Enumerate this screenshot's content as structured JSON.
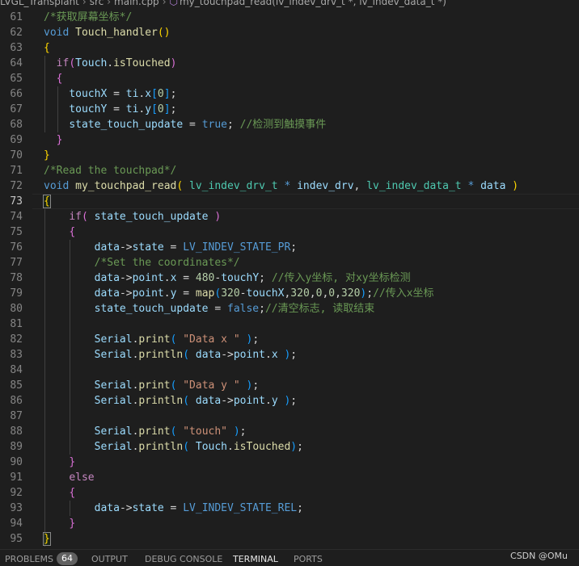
{
  "breadcrumb": {
    "items": [
      "LVGL_Transplant",
      "src",
      "main.cpp"
    ],
    "symbol": "my_touchpad_read(lv_indev_drv_t *, lv_indev_data_t *)",
    "symbol_icon": "cube-method-icon"
  },
  "editor": {
    "current_line": 73,
    "lines": [
      {
        "n": "61",
        "tokens": [
          [
            "cm",
            "/*获取屏幕坐标*/"
          ]
        ]
      },
      {
        "n": "62",
        "tokens": [
          [
            "kw",
            "void"
          ],
          [
            "txt",
            " "
          ],
          [
            "fn",
            "Touch_handler"
          ],
          [
            "b1",
            "()"
          ]
        ]
      },
      {
        "n": "63",
        "tokens": [
          [
            "b1",
            "{"
          ]
        ]
      },
      {
        "n": "64",
        "tokens": [
          [
            "txt",
            "  "
          ],
          [
            "ctl",
            "if"
          ],
          [
            "b2",
            "("
          ],
          [
            "var",
            "Touch"
          ],
          [
            "txt",
            "."
          ],
          [
            "fn",
            "isTouched"
          ],
          [
            "b2",
            ")"
          ]
        ]
      },
      {
        "n": "65",
        "tokens": [
          [
            "txt",
            "  "
          ],
          [
            "b2",
            "{"
          ]
        ]
      },
      {
        "n": "66",
        "tokens": [
          [
            "txt",
            "    "
          ],
          [
            "var",
            "touchX"
          ],
          [
            "txt",
            " = "
          ],
          [
            "var",
            "ti"
          ],
          [
            "txt",
            "."
          ],
          [
            "var",
            "x"
          ],
          [
            "b3",
            "["
          ],
          [
            "num",
            "0"
          ],
          [
            "b3",
            "]"
          ],
          [
            "txt",
            ";"
          ]
        ]
      },
      {
        "n": "67",
        "tokens": [
          [
            "txt",
            "    "
          ],
          [
            "var",
            "touchY"
          ],
          [
            "txt",
            " = "
          ],
          [
            "var",
            "ti"
          ],
          [
            "txt",
            "."
          ],
          [
            "var",
            "y"
          ],
          [
            "b3",
            "["
          ],
          [
            "num",
            "0"
          ],
          [
            "b3",
            "]"
          ],
          [
            "txt",
            ";"
          ]
        ]
      },
      {
        "n": "68",
        "tokens": [
          [
            "txt",
            "    "
          ],
          [
            "var",
            "state_touch_update"
          ],
          [
            "txt",
            " = "
          ],
          [
            "const",
            "true"
          ],
          [
            "txt",
            "; "
          ],
          [
            "cm",
            "//检测到触摸事件"
          ]
        ]
      },
      {
        "n": "69",
        "tokens": [
          [
            "txt",
            "  "
          ],
          [
            "b2",
            "}"
          ]
        ]
      },
      {
        "n": "70",
        "tokens": [
          [
            "b1",
            "}"
          ]
        ]
      },
      {
        "n": "71",
        "tokens": [
          [
            "cm",
            "/*Read the touchpad*/"
          ]
        ]
      },
      {
        "n": "72",
        "tokens": [
          [
            "kw",
            "void"
          ],
          [
            "txt",
            " "
          ],
          [
            "fn",
            "my_touchpad_read"
          ],
          [
            "b1",
            "("
          ],
          [
            "txt",
            " "
          ],
          [
            "type",
            "lv_indev_drv_t"
          ],
          [
            "txt",
            " "
          ],
          [
            "kw",
            "*"
          ],
          [
            "txt",
            " "
          ],
          [
            "var",
            "indev_drv"
          ],
          [
            "txt",
            ", "
          ],
          [
            "type",
            "lv_indev_data_t"
          ],
          [
            "txt",
            " "
          ],
          [
            "kw",
            "*"
          ],
          [
            "txt",
            " "
          ],
          [
            "var",
            "data"
          ],
          [
            "txt",
            " "
          ],
          [
            "b1",
            ")"
          ]
        ]
      },
      {
        "n": "73",
        "tokens": [
          [
            "b1hl",
            "{"
          ]
        ]
      },
      {
        "n": "74",
        "tokens": [
          [
            "txt",
            "    "
          ],
          [
            "ctl",
            "if"
          ],
          [
            "b2",
            "("
          ],
          [
            "txt",
            " "
          ],
          [
            "var",
            "state_touch_update"
          ],
          [
            "txt",
            " "
          ],
          [
            "b2",
            ")"
          ]
        ]
      },
      {
        "n": "75",
        "tokens": [
          [
            "txt",
            "    "
          ],
          [
            "b2",
            "{"
          ]
        ]
      },
      {
        "n": "76",
        "tokens": [
          [
            "txt",
            "        "
          ],
          [
            "var",
            "data"
          ],
          [
            "txt",
            "->"
          ],
          [
            "var",
            "state"
          ],
          [
            "txt",
            " = "
          ],
          [
            "const",
            "LV_INDEV_STATE_PR"
          ],
          [
            "txt",
            ";"
          ]
        ]
      },
      {
        "n": "77",
        "tokens": [
          [
            "txt",
            "        "
          ],
          [
            "cm",
            "/*Set the coordinates*/"
          ]
        ]
      },
      {
        "n": "78",
        "tokens": [
          [
            "txt",
            "        "
          ],
          [
            "var",
            "data"
          ],
          [
            "txt",
            "->"
          ],
          [
            "var",
            "point"
          ],
          [
            "txt",
            "."
          ],
          [
            "var",
            "x"
          ],
          [
            "txt",
            " = "
          ],
          [
            "num",
            "480"
          ],
          [
            "txt",
            "-"
          ],
          [
            "var",
            "touchY"
          ],
          [
            "txt",
            "; "
          ],
          [
            "cm",
            "//传入y坐标, 对xy坐标检测"
          ]
        ]
      },
      {
        "n": "79",
        "tokens": [
          [
            "txt",
            "        "
          ],
          [
            "var",
            "data"
          ],
          [
            "txt",
            "->"
          ],
          [
            "var",
            "point"
          ],
          [
            "txt",
            "."
          ],
          [
            "var",
            "y"
          ],
          [
            "txt",
            " = "
          ],
          [
            "fn",
            "map"
          ],
          [
            "b3",
            "("
          ],
          [
            "num",
            "320"
          ],
          [
            "txt",
            "-"
          ],
          [
            "var",
            "touchX"
          ],
          [
            "txt",
            ","
          ],
          [
            "num",
            "320"
          ],
          [
            "txt",
            ","
          ],
          [
            "num",
            "0"
          ],
          [
            "txt",
            ","
          ],
          [
            "num",
            "0"
          ],
          [
            "txt",
            ","
          ],
          [
            "num",
            "320"
          ],
          [
            "b3",
            ")"
          ],
          [
            "txt",
            ";"
          ],
          [
            "cm",
            "//传入x坐标"
          ]
        ]
      },
      {
        "n": "80",
        "tokens": [
          [
            "txt",
            "        "
          ],
          [
            "var",
            "state_touch_update"
          ],
          [
            "txt",
            " = "
          ],
          [
            "const",
            "false"
          ],
          [
            "txt",
            ";"
          ],
          [
            "cm",
            "//清空标志, 读取结束"
          ]
        ]
      },
      {
        "n": "81",
        "tokens": []
      },
      {
        "n": "82",
        "tokens": [
          [
            "txt",
            "        "
          ],
          [
            "var",
            "Serial"
          ],
          [
            "txt",
            "."
          ],
          [
            "fn",
            "print"
          ],
          [
            "b3",
            "("
          ],
          [
            "txt",
            " "
          ],
          [
            "str",
            "\"Data x \""
          ],
          [
            "txt",
            " "
          ],
          [
            "b3",
            ")"
          ],
          [
            "txt",
            ";"
          ]
        ]
      },
      {
        "n": "83",
        "tokens": [
          [
            "txt",
            "        "
          ],
          [
            "var",
            "Serial"
          ],
          [
            "txt",
            "."
          ],
          [
            "fn",
            "println"
          ],
          [
            "b3",
            "("
          ],
          [
            "txt",
            " "
          ],
          [
            "var",
            "data"
          ],
          [
            "txt",
            "->"
          ],
          [
            "var",
            "point"
          ],
          [
            "txt",
            "."
          ],
          [
            "var",
            "x"
          ],
          [
            "txt",
            " "
          ],
          [
            "b3",
            ")"
          ],
          [
            "txt",
            ";"
          ]
        ]
      },
      {
        "n": "84",
        "tokens": []
      },
      {
        "n": "85",
        "tokens": [
          [
            "txt",
            "        "
          ],
          [
            "var",
            "Serial"
          ],
          [
            "txt",
            "."
          ],
          [
            "fn",
            "print"
          ],
          [
            "b3",
            "("
          ],
          [
            "txt",
            " "
          ],
          [
            "str",
            "\"Data y \""
          ],
          [
            "txt",
            " "
          ],
          [
            "b3",
            ")"
          ],
          [
            "txt",
            ";"
          ]
        ]
      },
      {
        "n": "86",
        "tokens": [
          [
            "txt",
            "        "
          ],
          [
            "var",
            "Serial"
          ],
          [
            "txt",
            "."
          ],
          [
            "fn",
            "println"
          ],
          [
            "b3",
            "("
          ],
          [
            "txt",
            " "
          ],
          [
            "var",
            "data"
          ],
          [
            "txt",
            "->"
          ],
          [
            "var",
            "point"
          ],
          [
            "txt",
            "."
          ],
          [
            "var",
            "y"
          ],
          [
            "txt",
            " "
          ],
          [
            "b3",
            ")"
          ],
          [
            "txt",
            ";"
          ]
        ]
      },
      {
        "n": "87",
        "tokens": []
      },
      {
        "n": "88",
        "tokens": [
          [
            "txt",
            "        "
          ],
          [
            "var",
            "Serial"
          ],
          [
            "txt",
            "."
          ],
          [
            "fn",
            "print"
          ],
          [
            "b3",
            "("
          ],
          [
            "txt",
            " "
          ],
          [
            "str",
            "\"touch\""
          ],
          [
            "txt",
            " "
          ],
          [
            "b3",
            ")"
          ],
          [
            "txt",
            ";"
          ]
        ]
      },
      {
        "n": "89",
        "tokens": [
          [
            "txt",
            "        "
          ],
          [
            "var",
            "Serial"
          ],
          [
            "txt",
            "."
          ],
          [
            "fn",
            "println"
          ],
          [
            "b3",
            "("
          ],
          [
            "txt",
            " "
          ],
          [
            "var",
            "Touch"
          ],
          [
            "txt",
            "."
          ],
          [
            "fn",
            "isTouched"
          ],
          [
            "b3",
            ")"
          ],
          [
            "txt",
            ";"
          ]
        ]
      },
      {
        "n": "90",
        "tokens": [
          [
            "txt",
            "    "
          ],
          [
            "b2",
            "}"
          ]
        ]
      },
      {
        "n": "91",
        "tokens": [
          [
            "txt",
            "    "
          ],
          [
            "ctl",
            "else"
          ]
        ]
      },
      {
        "n": "92",
        "tokens": [
          [
            "txt",
            "    "
          ],
          [
            "b2",
            "{"
          ]
        ]
      },
      {
        "n": "93",
        "tokens": [
          [
            "txt",
            "        "
          ],
          [
            "var",
            "data"
          ],
          [
            "txt",
            "->"
          ],
          [
            "var",
            "state"
          ],
          [
            "txt",
            " = "
          ],
          [
            "const",
            "LV_INDEV_STATE_REL"
          ],
          [
            "txt",
            ";"
          ]
        ]
      },
      {
        "n": "94",
        "tokens": [
          [
            "txt",
            "    "
          ],
          [
            "b2",
            "}"
          ]
        ]
      },
      {
        "n": "95",
        "tokens": [
          [
            "b1hl",
            "}"
          ]
        ]
      }
    ]
  },
  "panel": {
    "tabs": [
      {
        "label": "PROBLEMS",
        "active": false
      },
      {
        "label": "OUTPUT",
        "active": false
      },
      {
        "label": "DEBUG CONSOLE",
        "active": false
      },
      {
        "label": "TERMINAL",
        "active": true
      },
      {
        "label": "PORTS",
        "active": false
      }
    ],
    "problems_count": "64"
  },
  "watermark": "CSDN @OMu",
  "colors": {
    "background": "#1e1e1e",
    "keyword": "#569cd6",
    "control": "#c586c0",
    "function": "#dcdcaa",
    "variable": "#9cdcfe",
    "type": "#4ec9b0",
    "comment": "#6a9955",
    "number": "#b5cea8",
    "string": "#ce9178"
  }
}
